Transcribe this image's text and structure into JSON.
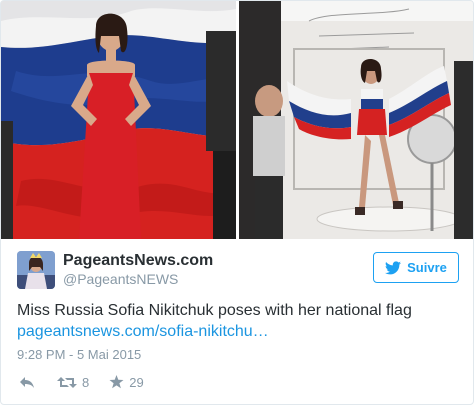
{
  "tweet": {
    "display_name": "PageantsNews.com",
    "handle": "@PageantsNEWS",
    "text": "Miss Russia Sofia Nikitchuk poses with her national flag",
    "link": "pageantsnews.com/sofia-nikitchu…",
    "timestamp": "9:28 PM - 5 Mai 2015",
    "follow_label": "Suivre",
    "retweet_count": "8",
    "like_count": "29"
  },
  "icons": {
    "follow": "twitter-bird-icon",
    "reply": "reply-arrow-icon",
    "retweet": "retweet-icon",
    "like": "star-icon"
  },
  "colors": {
    "accent": "#1da1f2",
    "link": "#1b95e0",
    "muted": "#8899a6",
    "text": "#292f33",
    "flag_white": "#f4f4f4",
    "flag_blue": "#1f3f8f",
    "flag_red": "#d9201f"
  }
}
